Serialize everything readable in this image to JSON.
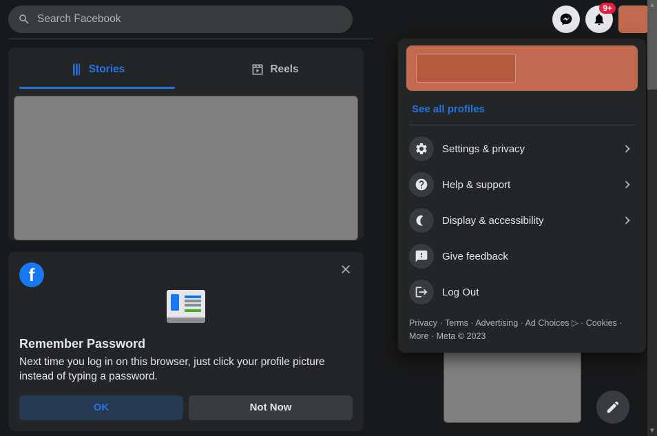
{
  "search": {
    "placeholder": "Search Facebook"
  },
  "topbar": {
    "notification_badge": "9+"
  },
  "tabs": {
    "stories": "Stories",
    "reels": "Reels"
  },
  "remember": {
    "title": "Remember Password",
    "body": "Next time you log in on this browser, just click your profile picture instead of typing a password.",
    "ok": "OK",
    "not_now": "Not Now"
  },
  "dropdown": {
    "see_all_profiles": "See all profiles",
    "items": [
      {
        "label": "Settings & privacy",
        "chevron": true
      },
      {
        "label": "Help & support",
        "chevron": true
      },
      {
        "label": "Display & accessibility",
        "chevron": true
      },
      {
        "label": "Give feedback",
        "chevron": false
      },
      {
        "label": "Log Out",
        "chevron": false
      }
    ]
  },
  "footer": {
    "links": [
      "Privacy",
      "Terms",
      "Advertising",
      "Ad Choices ▷",
      "Cookies",
      "More"
    ],
    "copyright": "Meta © 2023"
  }
}
